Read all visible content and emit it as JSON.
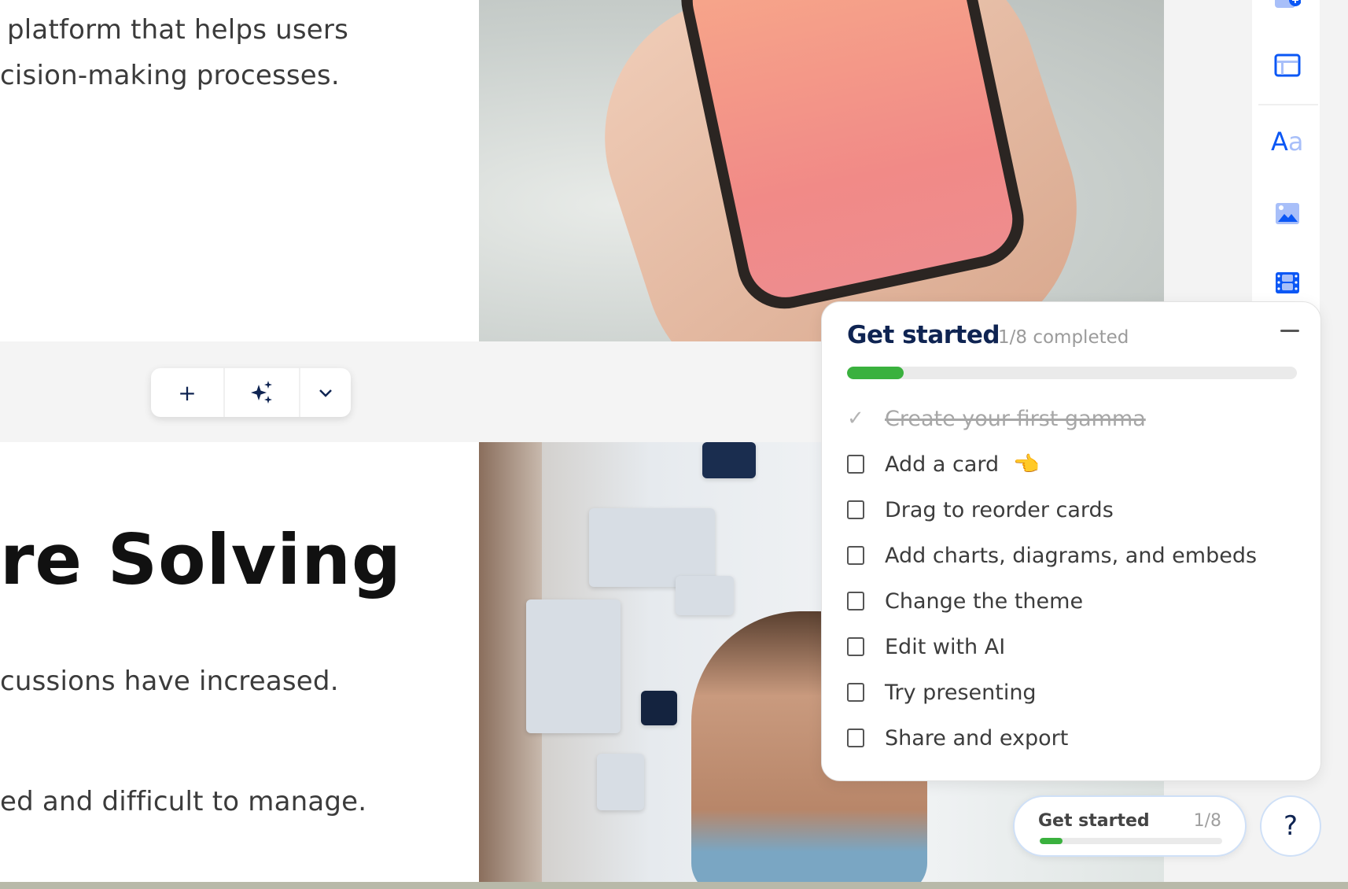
{
  "card1": {
    "text_line1": "platform that helps users",
    "text_line2": "cision-making processes."
  },
  "card2": {
    "heading": "re Solving",
    "text_line1": "cussions have increased.",
    "text_line2": "ed and difficult to manage."
  },
  "toolbar": {
    "add_icon": "+",
    "ai_icon": "sparkles",
    "chevron_icon": "chevron-down"
  },
  "sidebar": {
    "icons": [
      "add-card-icon",
      "layout-icon",
      "text-icon",
      "image-icon",
      "video-icon"
    ],
    "text_icon_label": "Aa"
  },
  "get_started": {
    "title": "Get started",
    "count": "1/8 completed",
    "progress_fraction": 0.125,
    "items": [
      {
        "label": "Create your first gamma",
        "done": true
      },
      {
        "label": "Add a card",
        "done": false,
        "emoji": "👈"
      },
      {
        "label": "Drag to reorder cards",
        "done": false
      },
      {
        "label": "Add charts, diagrams, and embeds",
        "done": false
      },
      {
        "label": "Change the theme",
        "done": false
      },
      {
        "label": "Edit with AI",
        "done": false
      },
      {
        "label": "Try presenting",
        "done": false
      },
      {
        "label": "Share and export",
        "done": false
      }
    ]
  },
  "pill": {
    "label": "Get started",
    "count": "1/8",
    "progress_fraction": 0.125
  },
  "help": {
    "label": "?"
  },
  "colors": {
    "accent": "#0f2452",
    "progress": "#3ab13e",
    "sidebar_icon": "#0b57f5"
  }
}
